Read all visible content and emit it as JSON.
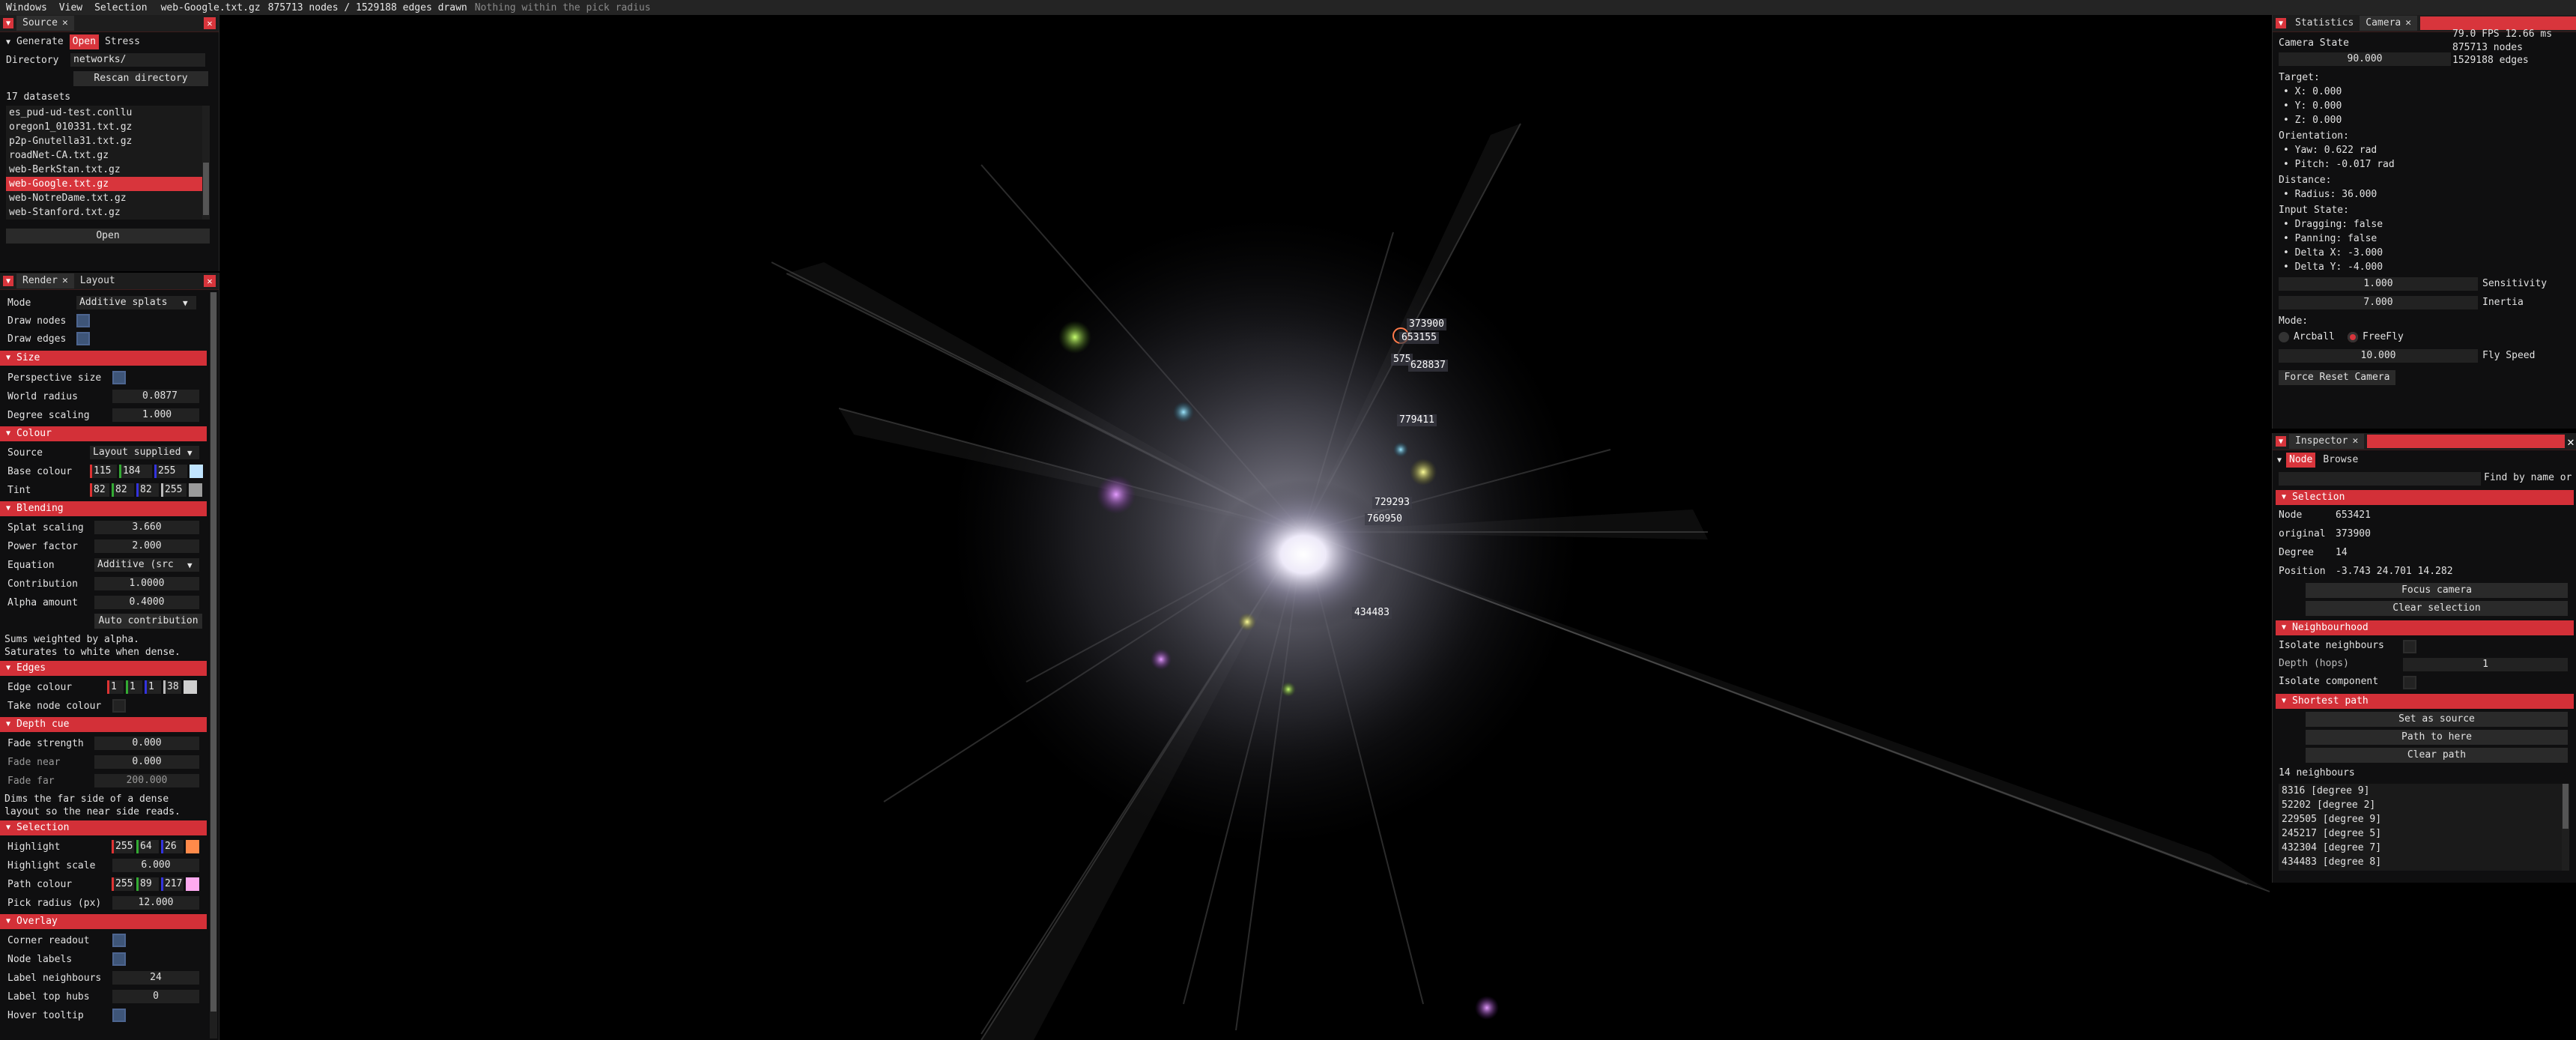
{
  "menubar": {
    "items": [
      "Windows",
      "View",
      "Selection"
    ],
    "file": "web-Google.txt.gz",
    "counts": "875713 nodes / 1529188 edges drawn",
    "hint": "Nothing within the pick radius"
  },
  "source_panel": {
    "title": "Source",
    "tabs": [
      "Generate",
      "Open",
      "Stress"
    ],
    "active_tab": "Open",
    "directory_label": "Directory",
    "directory_value": "networks/",
    "rescan_label": "Rescan directory",
    "datasets_count": "17 datasets",
    "datasets": [
      "es_pud-ud-test.conllu",
      "oregon1_010331.txt.gz",
      "p2p-Gnutella31.txt.gz",
      "roadNet-CA.txt.gz",
      "web-BerkStan.txt.gz",
      "web-Google.txt.gz",
      "web-NotreDame.txt.gz",
      "web-Stanford.txt.gz"
    ],
    "selected_dataset": "web-Google.txt.gz",
    "open_label": "Open"
  },
  "render_panel": {
    "tabs": [
      "Render",
      "Layout"
    ],
    "active_tab": "Render",
    "mode_label": "Mode",
    "mode_value": "Additive splats",
    "draw_nodes_label": "Draw nodes",
    "draw_edges_label": "Draw edges",
    "size_header": "Size",
    "perspective_label": "Perspective size",
    "world_radius_label": "World radius",
    "world_radius_value": "0.0877",
    "degree_scaling_label": "Degree scaling",
    "degree_scaling_value": "1.000",
    "colour_header": "Colour",
    "source_label": "Source",
    "source_value": "Layout supplied",
    "base_colour_label": "Base colour",
    "base_colour": [
      "115",
      "184",
      "255"
    ],
    "base_swatch": "#73b8ff",
    "tint_label": "Tint",
    "tint": [
      "82",
      "82",
      "82",
      "255"
    ],
    "tint_swatch": "#525252",
    "blending_header": "Blending",
    "splat_scaling_label": "Splat scaling",
    "splat_scaling_value": "3.660",
    "power_factor_label": "Power factor",
    "power_factor_value": "2.000",
    "equation_label": "Equation",
    "equation_value": "Additive (src",
    "contribution_label": "Contribution",
    "contribution_value": "1.0000",
    "alpha_label": "Alpha amount",
    "alpha_value": "0.4000",
    "auto_contribution_label": "Auto contribution",
    "note1": "Sums weighted by alpha.",
    "note2": "Saturates to white when dense.",
    "edges_header": "Edges",
    "edge_colour_label": "Edge colour",
    "edge_colour": [
      "1",
      "1",
      "1",
      "38"
    ],
    "take_node_colour_label": "Take node colour",
    "depth_header": "Depth cue",
    "fade_strength_label": "Fade strength",
    "fade_strength_value": "0.000",
    "fade_near_label": "Fade near",
    "fade_near_value": "0.000",
    "fade_far_label": "Fade far",
    "fade_far_value": "200.000",
    "depth_note1": "Dims the far side of a dense",
    "depth_note2": "layout so the near side reads.",
    "selection_header": "Selection",
    "highlight_label": "Highlight",
    "highlight": [
      "255",
      "64",
      "26"
    ],
    "highlight_swatch": "#ff7a4a",
    "highlight_scale_label": "Highlight scale",
    "highlight_scale_value": "6.000",
    "path_colour_label": "Path colour",
    "path_colour": [
      "255",
      "89",
      "217"
    ],
    "path_swatch": "#ffb3f0",
    "pick_radius_label": "Pick radius (px)",
    "pick_radius_value": "12.000",
    "overlay_header": "Overlay",
    "corner_readout_label": "Corner readout",
    "node_labels_label": "Node labels",
    "label_neighbours_label": "Label neighbours",
    "label_neighbours_value": "24",
    "label_top_hubs_label": "Label top hubs",
    "label_top_hubs_value": "0",
    "hover_tooltip_label": "Hover tooltip"
  },
  "statistics_panel": {
    "tabs": [
      "Statistics",
      "Camera"
    ],
    "fps": "79.0 FPS  12.66 ms",
    "nodes": "875713 nodes",
    "edges": "1529188 edges",
    "camera_state_label": "Camera State",
    "fov_value": "90.000",
    "target_label": "Target:",
    "target": [
      "X: 0.000",
      "Y: 0.000",
      "Z: 0.000"
    ],
    "orientation_label": "Orientation:",
    "orientation": [
      "Yaw: 0.622 rad",
      "Pitch: -0.017 rad"
    ],
    "distance_label": "Distance:",
    "distance": [
      "Radius: 36.000"
    ],
    "input_label": "Input State:",
    "input": [
      "Dragging: false",
      "Panning: false",
      "Delta X: -3.000",
      "Delta Y: -4.000"
    ],
    "sensitivity_value": "1.000",
    "sensitivity_label": "Sensitivity",
    "inertia_value": "7.000",
    "inertia_label": "Inertia",
    "mode_label": "Mode:",
    "mode_options": [
      "Arcball",
      "FreeFly"
    ],
    "mode_selected": "FreeFly",
    "fly_speed_value": "10.000",
    "fly_speed_label": "Fly Speed",
    "reset_label": "Force Reset Camera"
  },
  "inspector_panel": {
    "title": "Inspector",
    "tabs": [
      "Node",
      "Browse"
    ],
    "active_tab": "Node",
    "find_label": "Find by name or",
    "selection_header": "Selection",
    "node_label": "Node",
    "node_value": "653421",
    "original_label": "original",
    "original_value": "373900",
    "degree_label": "Degree",
    "degree_value": "14",
    "position_label": "Position",
    "position_value": "-3.743 24.701 14.282",
    "focus_label": "Focus camera",
    "clear_selection_label": "Clear selection",
    "neighbourhood_header": "Neighbourhood",
    "isolate_neighbours_label": "Isolate neighbours",
    "depth_hops_label": "Depth (hops)",
    "depth_hops_value": "1",
    "isolate_component_label": "Isolate component",
    "shortest_path_header": "Shortest path",
    "set_source_label": "Set as source",
    "path_here_label": "Path to here",
    "clear_path_label": "Clear path",
    "neighbours_count": "14 neighbours",
    "neighbours": [
      "8316  [degree 9]",
      "52202  [degree 2]",
      "229505  [degree 9]",
      "245217  [degree 5]",
      "432304  [degree 7]",
      "434483  [degree 8]"
    ]
  },
  "viewport_labels": [
    "373900",
    "653155",
    "575",
    "628837",
    "779411",
    "729293",
    "760950",
    "434483"
  ],
  "colors": {
    "accent": "#d8353c",
    "panel_bg": "#0f0f10",
    "field_bg": "#222222"
  }
}
